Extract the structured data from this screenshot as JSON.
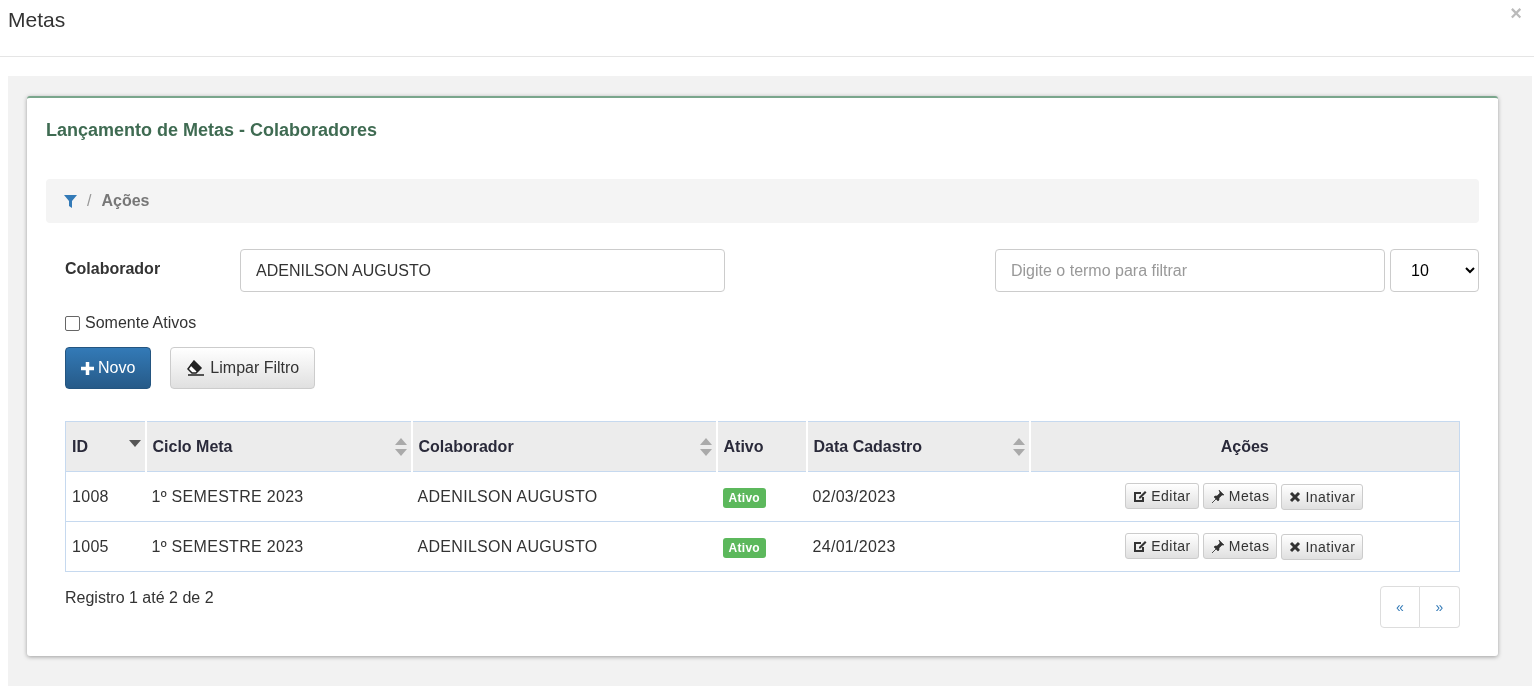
{
  "window": {
    "title": "Metas",
    "close": "×"
  },
  "panel": {
    "title": "Lançamento de Metas - Colaboradores"
  },
  "breadcrumb": {
    "separator": "/",
    "items": [
      "Ações"
    ]
  },
  "filter": {
    "label": "Colaborador",
    "value": "ADENILSON AUGUSTO",
    "search_placeholder": "Digite o termo para filtrar",
    "page_size": "10",
    "only_active": {
      "label": "Somente Ativos",
      "checked": false
    }
  },
  "buttons": [
    {
      "kind": "primary",
      "label": "Novo"
    },
    {
      "kind": "default",
      "label": "Limpar Filtro"
    }
  ],
  "table": {
    "columns": [
      {
        "label": "ID",
        "sortable": true,
        "sorted": true
      },
      {
        "label": "Ciclo Meta",
        "sortable": true,
        "sorted": false
      },
      {
        "label": "Colaborador",
        "sortable": true,
        "sorted": false
      },
      {
        "label": "Ativo",
        "sortable": false,
        "sorted": false
      },
      {
        "label": "Data Cadastro",
        "sortable": true,
        "sorted": false
      },
      {
        "label": "Ações",
        "sortable": false,
        "sorted": false
      }
    ],
    "rows": [
      {
        "id": "1008",
        "cycle": "1º SEMESTRE 2023",
        "employee": "ADENILSON AUGUSTO",
        "status": "Ativo",
        "date": "02/03/2023",
        "actions": [
          {
            "kind": "edit",
            "label": "Editar"
          },
          {
            "kind": "pin",
            "label": "Metas"
          },
          {
            "kind": "remove",
            "label": "Inativar"
          }
        ]
      },
      {
        "id": "1005",
        "cycle": "1º SEMESTRE 2023",
        "employee": "ADENILSON AUGUSTO",
        "status": "Ativo",
        "date": "24/01/2023",
        "actions": [
          {
            "kind": "edit",
            "label": "Editar"
          },
          {
            "kind": "pin",
            "label": "Metas"
          },
          {
            "kind": "remove",
            "label": "Inativar"
          }
        ]
      }
    ]
  },
  "footer": {
    "summary": "Registro 1 até 2 de 2",
    "pagination": [
      "«",
      "»"
    ]
  }
}
